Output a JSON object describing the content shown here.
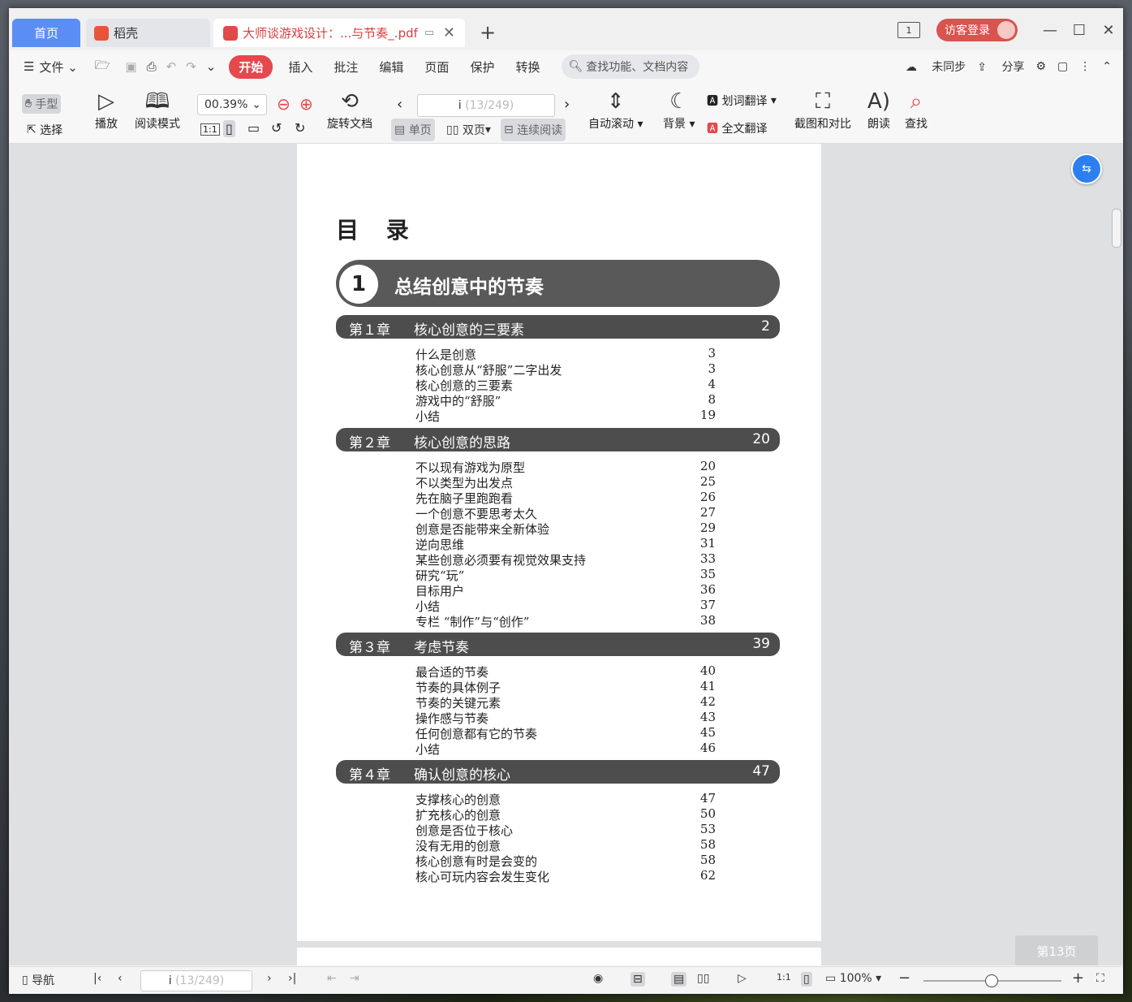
{
  "tabs": {
    "home": "首页",
    "daoke": "稻壳",
    "doc": "大师谈游戏设计：...与节奏_.pdf",
    "new": "+"
  },
  "titlebar": {
    "window_count": "1",
    "login": "访客登录"
  },
  "menu": {
    "file": "文件",
    "items": [
      "开始",
      "插入",
      "批注",
      "编辑",
      "页面",
      "保护",
      "转换"
    ],
    "search_placeholder": "查找功能、文档内容",
    "sync": "未同步",
    "share": "分享"
  },
  "ribbon": {
    "hand": "手型",
    "select": "选择",
    "play": "播放",
    "read_mode": "阅读模式",
    "zoom": "00.39%",
    "rotate": "旋转文档",
    "page_current": "i",
    "page_total": "(13/249)",
    "single": "单页",
    "double": "双页",
    "continuous": "连续阅读",
    "auto_scroll": "自动滚动",
    "background": "背景",
    "word_translate": "划词翻译",
    "full_translate": "全文翻译",
    "screenshot": "截图和对比",
    "read_aloud": "朗读",
    "find": "查找"
  },
  "doc": {
    "toc_title": "目 录",
    "part": {
      "badge": "1",
      "title": "总结创意中的节奏"
    },
    "chapters": [
      {
        "num": "第１章",
        "title": "核心创意的三要素",
        "page": "2",
        "entries": [
          [
            "什么是创意",
            "3"
          ],
          [
            "核心创意从“舒服”二字出发",
            "3"
          ],
          [
            "核心创意的三要素",
            "4"
          ],
          [
            "游戏中的“舒服”",
            "8"
          ],
          [
            "小结",
            "19"
          ]
        ]
      },
      {
        "num": "第２章",
        "title": "核心创意的思路",
        "page": "20",
        "entries": [
          [
            "不以现有游戏为原型",
            "20"
          ],
          [
            "不以类型为出发点",
            "25"
          ],
          [
            "先在脑子里跑跑看",
            "26"
          ],
          [
            "一个创意不要思考太久",
            "27"
          ],
          [
            "创意是否能带来全新体验",
            "29"
          ],
          [
            "逆向思维",
            "31"
          ],
          [
            "某些创意必须要有视觉效果支持",
            "33"
          ],
          [
            "研究“玩”",
            "35"
          ],
          [
            "目标用户",
            "36"
          ],
          [
            "小结",
            "37"
          ],
          [
            "专栏 “制作”与“创作”",
            "38"
          ]
        ]
      },
      {
        "num": "第３章",
        "title": "考虑节奏",
        "page": "39",
        "entries": [
          [
            "最合适的节奏",
            "40"
          ],
          [
            "节奏的具体例子",
            "41"
          ],
          [
            "节奏的关键元素",
            "42"
          ],
          [
            "操作感与节奏",
            "43"
          ],
          [
            "任何创意都有它的节奏",
            "45"
          ],
          [
            "小结",
            "46"
          ]
        ]
      },
      {
        "num": "第４章",
        "title": "确认创意的核心",
        "page": "47",
        "entries": [
          [
            "支撑核心的创意",
            "47"
          ],
          [
            "扩充核心的创意",
            "50"
          ],
          [
            "创意是否位于核心",
            "53"
          ],
          [
            "没有无用的创意",
            "58"
          ],
          [
            "核心创意有时是会变的",
            "58"
          ],
          [
            "核心可玩内容会发生变化",
            "62"
          ]
        ]
      }
    ]
  },
  "page_indicator": "第13页",
  "status": {
    "nav": "导航",
    "page_current": "i",
    "page_total": "(13/249)",
    "zoom": "100%"
  }
}
